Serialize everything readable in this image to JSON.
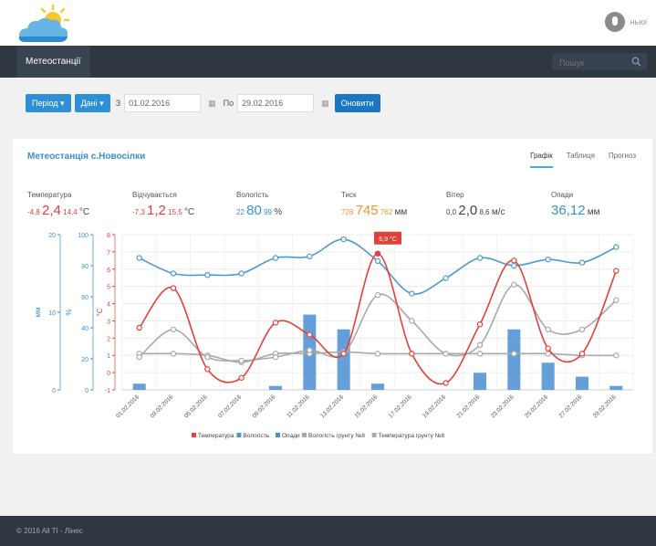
{
  "header": {
    "user_name": "ньюі"
  },
  "nav": {
    "item": "Метеостанції",
    "search_placeholder": "Пошук"
  },
  "filters": {
    "period_label": "Період",
    "data_label": "Дані",
    "from_label": "З",
    "from_date": "01.02.2016",
    "to_label": "По",
    "to_date": "29.02.2016",
    "refresh_label": "Оновити"
  },
  "panel": {
    "title": "Метеостанція с.Новосілки",
    "tabs": [
      "Графік",
      "Таблиця",
      "Прогноз"
    ],
    "active_tab": "Графік"
  },
  "stats": [
    {
      "label": "Температура",
      "min": "-4,8",
      "value": "2,4",
      "max": "14,4",
      "unit": "°C",
      "color": "#e0413a"
    },
    {
      "label": "Відчувається",
      "min": "-7,3",
      "value": "1,2",
      "max": "15,5",
      "unit": "°C",
      "color": "#e0413a"
    },
    {
      "label": "Вологість",
      "min": "22",
      "value": "80",
      "max": "99",
      "unit": "%",
      "color": "#3a8fd0"
    },
    {
      "label": "Тиск",
      "min": "728",
      "value": "745",
      "max": "762",
      "unit": "мм",
      "color": "#f0962c"
    },
    {
      "label": "Вітер",
      "min": "0,0",
      "value": "2,0",
      "max": "8,6",
      "unit": "м/с",
      "color": "#444444"
    },
    {
      "label": "Опади",
      "min": "",
      "value": "36,12",
      "max": "",
      "unit": "мм",
      "color": "#3a8fd0"
    }
  ],
  "chart_data": {
    "type": "line",
    "categories": [
      "01.02.2016",
      "03.02.2016",
      "05.02.2016",
      "07.02.2016",
      "09.02.2016",
      "11.02.2016",
      "13.02.2016",
      "15.02.2016",
      "17.02.2016",
      "19.02.2016",
      "21.02.2016",
      "23.02.2016",
      "25.02.2016",
      "27.02.2016",
      "29.02.2016"
    ],
    "axes": {
      "precip": {
        "label": "мм",
        "ticks": [
          "0",
          "10",
          "20"
        ],
        "range": [
          0,
          20
        ],
        "color": "#3a8fd0"
      },
      "humidity": {
        "label": "%",
        "ticks": [
          "0",
          "20",
          "40",
          "60",
          "80",
          "100"
        ],
        "range": [
          0,
          100
        ],
        "color": "#3a8fd0"
      },
      "temp": {
        "label": "°C",
        "ticks": [
          "-1",
          "0",
          "1",
          "2",
          "3",
          "4",
          "5",
          "6",
          "7",
          "8"
        ],
        "range": [
          -1,
          8
        ],
        "color": "#e0413a"
      }
    },
    "series": [
      {
        "name": "Температура",
        "axis": "temp",
        "color": "#e0413a",
        "values": [
          2.6,
          4.9,
          0.2,
          -0.3,
          2.9,
          2.2,
          1.1,
          6.9,
          1.1,
          -0.6,
          2.8,
          6.5,
          1.4,
          1.1,
          5.9
        ]
      },
      {
        "name": "Вологість",
        "axis": "humidity",
        "color": "#4a9ad6",
        "values": [
          85,
          75,
          74,
          75,
          85,
          86,
          97,
          83,
          62,
          72,
          85,
          80,
          84,
          82,
          92
        ]
      },
      {
        "name": "Опади",
        "axis": "precip",
        "color": "#4a8ed2",
        "type": "bar",
        "values": [
          0.8,
          0,
          0,
          0,
          0.5,
          9.7,
          7.8,
          0.8,
          0,
          0,
          2.2,
          7.8,
          3.5,
          1.7,
          0.5
        ]
      },
      {
        "name": "Вологість грунту №8",
        "axis": "temp",
        "color": "#a9a9a9",
        "values": [
          0.9,
          2.5,
          0.9,
          0.7,
          0.9,
          1.3,
          1.1,
          4.5,
          3.0,
          1.1,
          1.6,
          5.1,
          2.5,
          2.5,
          4.2
        ]
      },
      {
        "name": "Температура грунту №8",
        "axis": "temp",
        "color": "#a9a9a9",
        "values": [
          1.1,
          1.1,
          1.0,
          0.6,
          1.1,
          1.1,
          1.2,
          1.1,
          1.1,
          1.1,
          1.1,
          1.1,
          1.1,
          1.0,
          1.0
        ]
      }
    ],
    "annotation": {
      "text": "6,9 °C",
      "category": "15.02.2016"
    },
    "grid": true,
    "legend": "bottom"
  },
  "footer": {
    "text": "© 2016 All TI - Лінес"
  }
}
